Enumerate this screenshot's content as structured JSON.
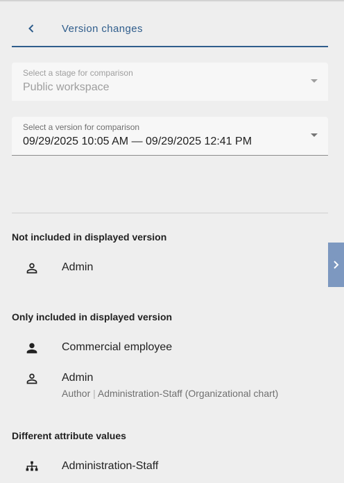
{
  "header": {
    "title": "Version changes"
  },
  "stage_select": {
    "label": "Select a stage for comparison",
    "value": "Public workspace"
  },
  "version_select": {
    "label": "Select a version for comparison",
    "value": "09/29/2025 10:05 AM — 09/29/2025 12:41 PM"
  },
  "sections": {
    "not_included": {
      "title": "Not included in displayed version",
      "items": [
        {
          "label": "Admin",
          "icon": "person-outline-icon"
        }
      ]
    },
    "only_included": {
      "title": "Only included in displayed version",
      "items": [
        {
          "label": "Commercial employee",
          "icon": "person-filled-icon"
        },
        {
          "label": "Admin",
          "icon": "person-outline-icon",
          "role": "Author",
          "separator": "|",
          "target": "Administration-Staff (Organizational chart)"
        }
      ]
    },
    "different_attributes": {
      "title": "Different attribute values",
      "items": [
        {
          "label": "Administration-Staff",
          "icon": "org-chart-icon"
        }
      ]
    }
  },
  "colors": {
    "accent": "#2f5d8c",
    "side_tab": "#7d98c0",
    "background": "#eeeeee"
  }
}
